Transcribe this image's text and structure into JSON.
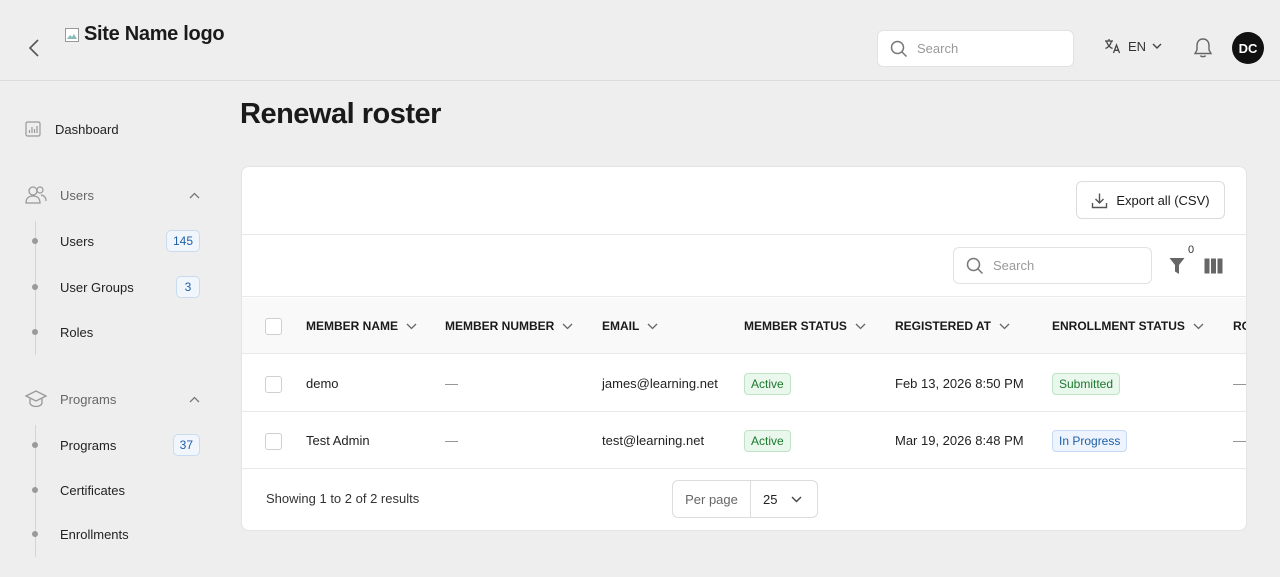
{
  "header": {
    "logo_alt": "Site Name logo",
    "search_placeholder": "Search",
    "language": "EN",
    "avatar_initials": "DC"
  },
  "sidebar": {
    "dashboard": "Dashboard",
    "groups": [
      {
        "label": "Users",
        "items": [
          {
            "label": "Users",
            "count": "145"
          },
          {
            "label": "User Groups",
            "count": "3"
          },
          {
            "label": "Roles",
            "count": null
          }
        ]
      },
      {
        "label": "Programs",
        "items": [
          {
            "label": "Programs",
            "count": "37"
          },
          {
            "label": "Certificates",
            "count": null
          },
          {
            "label": "Enrollments",
            "count": null
          }
        ]
      }
    ]
  },
  "page": {
    "title": "Renewal roster",
    "export_label": "Export all (CSV)",
    "search_placeholder": "Search",
    "filter_count": "0"
  },
  "table": {
    "columns": [
      "MEMBER NAME",
      "MEMBER NUMBER",
      "EMAIL",
      "MEMBER STATUS",
      "REGISTERED AT",
      "ENROLLMENT STATUS",
      "RO"
    ],
    "rows": [
      {
        "name": "demo",
        "number": "—",
        "email": "james@learning.net",
        "member_status": "Active",
        "registered_at": "Feb 13, 2026 8:50 PM",
        "enrollment_status": "Submitted",
        "extra": "—"
      },
      {
        "name": "Test Admin",
        "number": "—",
        "email": "test@learning.net",
        "member_status": "Active",
        "registered_at": "Mar 19, 2026 8:48 PM",
        "enrollment_status": "In Progress",
        "extra": "—"
      }
    ]
  },
  "footer": {
    "showing": "Showing 1 to 2 of 2 results",
    "per_page_label": "Per page",
    "per_page_value": "25"
  },
  "colors": {
    "status_green": "#1a7a2e",
    "status_blue": "#1f5fa8",
    "count_badge": "#1f5fa8"
  }
}
